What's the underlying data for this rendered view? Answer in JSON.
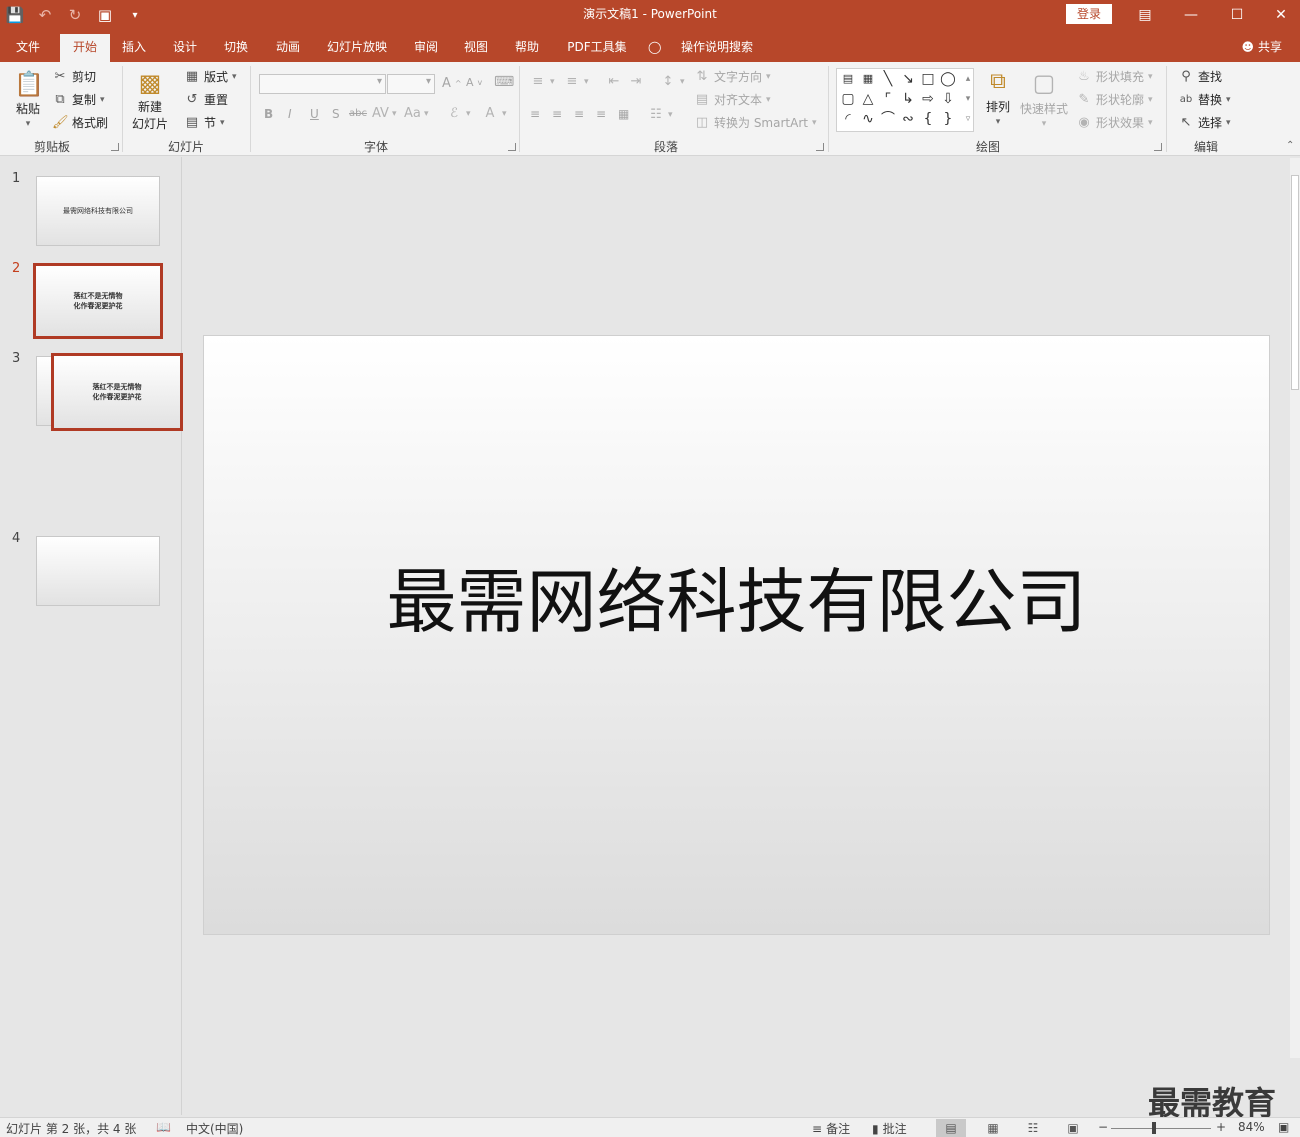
{
  "titlebar": {
    "title": "演示文稿1  -  PowerPoint",
    "login": "登录"
  },
  "tabs": [
    "文件",
    "开始",
    "插入",
    "设计",
    "切换",
    "动画",
    "幻灯片放映",
    "审阅",
    "视图",
    "帮助",
    "PDF工具集",
    "操作说明搜索"
  ],
  "active_tab": "开始",
  "share": "共享",
  "ribbon": {
    "clipboard": {
      "paste": "粘贴",
      "cut": "剪切",
      "copy": "复制",
      "format_painter": "格式刷",
      "label": "剪贴板"
    },
    "slides": {
      "new_slide_1": "新建",
      "new_slide_2": "幻灯片",
      "layout": "版式",
      "reset": "重置",
      "section": "节",
      "label": "幻灯片"
    },
    "font": {
      "bold": "B",
      "italic": "I",
      "underline": "U",
      "shadow": "S",
      "strike": "abc",
      "label": "字体"
    },
    "paragraph": {
      "text_direction": "文字方向",
      "align_text": "对齐文本",
      "smartart": "转换为 SmartArt",
      "label": "段落"
    },
    "drawing": {
      "arrange": "排列",
      "quick_styles": "快速样式",
      "shape_fill": "形状填充",
      "shape_outline": "形状轮廓",
      "shape_effects": "形状效果",
      "label": "绘图"
    },
    "editing": {
      "find": "查找",
      "replace": "替换",
      "select": "选择",
      "label": "编辑"
    }
  },
  "slides": [
    {
      "number": "1",
      "line1": "最需网络科技有限公司",
      "line2": "",
      "selected": false
    },
    {
      "number": "2",
      "line1": "落红不是无情物",
      "line2": "化作春泥更护花",
      "selected": true
    },
    {
      "number": "3",
      "line1": "落红不是无情物",
      "line2": "化作春泥更护花",
      "selected": false
    },
    {
      "number": "4",
      "line1": "",
      "line2": "",
      "selected": false
    }
  ],
  "main_slide": {
    "title": "最需网络科技有限公司"
  },
  "watermark": "最需教育",
  "status": {
    "slide_info": "幻灯片 第 2 张，共 4 张",
    "language": "中文(中国)",
    "notes": "备注",
    "comments": "批注",
    "zoom_minus": "−",
    "zoom_plus": "+",
    "zoom": "84%"
  }
}
